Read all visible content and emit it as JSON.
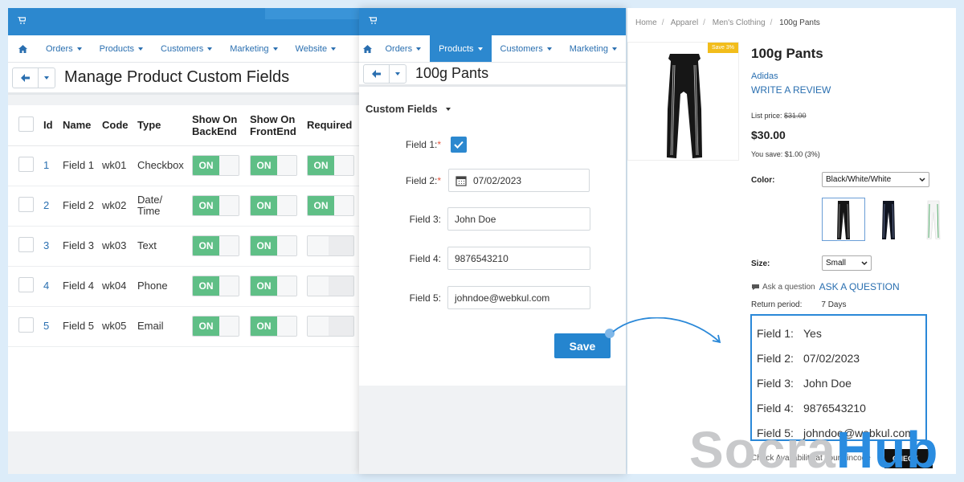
{
  "colors": {
    "primary": "#2c88cf",
    "toggle_on": "#5fbf86",
    "highlight_border": "#2a88d8",
    "sale_flag": "#f2bd1b"
  },
  "admin_list": {
    "nav": [
      "Orders",
      "Products",
      "Customers",
      "Marketing",
      "Website"
    ],
    "title": "Manage Product Custom Fields",
    "headers": {
      "id": "Id",
      "name": "Name",
      "code": "Code",
      "type": "Type",
      "backend": "Show On BackEnd",
      "frontend": "Show On FrontEnd",
      "required": "Required"
    },
    "toggle_on_label": "ON",
    "rows": [
      {
        "id": "1",
        "name": "Field 1",
        "code": "wk01",
        "type": "Checkbox",
        "backend": true,
        "frontend": true,
        "required": true
      },
      {
        "id": "2",
        "name": "Field 2",
        "code": "wk02",
        "type": "Date/ Time",
        "backend": true,
        "frontend": true,
        "required": true
      },
      {
        "id": "3",
        "name": "Field 3",
        "code": "wk03",
        "type": "Text",
        "backend": true,
        "frontend": true,
        "required": false
      },
      {
        "id": "4",
        "name": "Field 4",
        "code": "wk04",
        "type": "Phone",
        "backend": true,
        "frontend": true,
        "required": false
      },
      {
        "id": "5",
        "name": "Field 5",
        "code": "wk05",
        "type": "Email",
        "backend": true,
        "frontend": true,
        "required": false
      }
    ]
  },
  "admin_edit": {
    "nav": [
      "Orders",
      "Products",
      "Customers",
      "Marketing"
    ],
    "active_nav": "Products",
    "title": "100g Pants",
    "section": "Custom Fields",
    "fields": {
      "f1_label": "Field 1:",
      "f1_checked": true,
      "f2_label": "Field 2:",
      "f2_value": "07/02/2023",
      "f3_label": "Field 3:",
      "f3_value": "John Doe",
      "f4_label": "Field 4:",
      "f4_value": "9876543210",
      "f5_label": "Field 5:",
      "f5_value": "johndoe@webkul.com",
      "required_mark": "*"
    },
    "save_label": "Save"
  },
  "storefront": {
    "breadcrumb": [
      "Home",
      "Apparel",
      "Men's Clothing",
      "100g Pants"
    ],
    "save_flag": "Save 3%",
    "product_name": "100g Pants",
    "brand": "Adidas",
    "write_review": "WRITE A REVIEW",
    "list_price_label": "List price:",
    "list_price": "$31.00",
    "price": "$30.00",
    "you_save": "You save: $1.00 (3%)",
    "color_label": "Color:",
    "color_value": "Black/White/White",
    "size_label": "Size:",
    "size_value": "Small",
    "ask_question_small": "Ask a question",
    "ask_question_big": "ASK A QUESTION",
    "return_period_label": "Return period:",
    "return_period_value": "7 Days",
    "custom_fields": [
      {
        "label": "Field 1:",
        "value": "Yes"
      },
      {
        "label": "Field 2:",
        "value": "07/02/2023"
      },
      {
        "label": "Field 3:",
        "value": "John Doe"
      },
      {
        "label": "Field 4:",
        "value": "9876543210"
      },
      {
        "label": "Field 5:",
        "value": "johndoe@webkul.com"
      }
    ],
    "check_availability": "Check Availability at your pincode",
    "check_button": "CHECK"
  },
  "watermark": {
    "part1": "Socra",
    "part2": "Hub"
  }
}
